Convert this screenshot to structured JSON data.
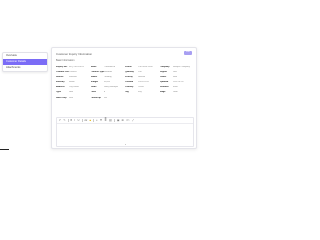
{
  "menu": {
    "items": [
      {
        "label": "Overview",
        "active": false
      },
      {
        "label": "Customer Details",
        "active": true
      },
      {
        "label": "Attachments",
        "active": false
      }
    ]
  },
  "card": {
    "title": "Customer Inquiry Information",
    "action_label": "Edit",
    "subtitle": "Basic Information"
  },
  "fields": [
    {
      "label": "Inquiry No.",
      "value": "INQ-2024-0012"
    },
    {
      "label": "Name",
      "value": "Customer A"
    },
    {
      "label": "Phone",
      "value": "138 0000 0000"
    },
    {
      "label": "Company",
      "value": "Sample Company"
    },
    {
      "label": "Contact Person",
      "value": "Contact"
    },
    {
      "label": "Product Type",
      "value": "Standard"
    },
    {
      "label": "Quantity",
      "value": "100"
    },
    {
      "label": "Region",
      "value": "East"
    },
    {
      "label": "Source",
      "value": "Website"
    },
    {
      "label": "Status",
      "value": "Pending"
    },
    {
      "label": "Priority",
      "value": "Normal"
    },
    {
      "label": "Owner",
      "value": "Staff"
    },
    {
      "label": "Industry",
      "value": "Retail"
    },
    {
      "label": "Budget",
      "value": "10,000"
    },
    {
      "label": "Created",
      "value": "2024-01-01"
    },
    {
      "label": "Updated",
      "value": "2024-01-02"
    },
    {
      "label": "Address",
      "value": "City Road"
    },
    {
      "label": "Email",
      "value": "mail@example"
    },
    {
      "label": "Country",
      "value": "China"
    },
    {
      "label": "Remarks",
      "value": "None"
    },
    {
      "label": "Type",
      "value": "New"
    },
    {
      "label": "Level",
      "value": "A"
    },
    {
      "label": "Tag",
      "value": "Key"
    },
    {
      "label": "Stage",
      "value": "Initial"
    },
    {
      "label": "Sales Rep",
      "value": "Staff"
    },
    {
      "label": "Follow-up",
      "value": "Yes"
    }
  ],
  "editor": {
    "toolbar": [
      {
        "icon": "undo-icon",
        "glyph": "↶"
      },
      {
        "icon": "redo-icon",
        "glyph": "↷"
      },
      {
        "icon": "bold-icon",
        "glyph": "B"
      },
      {
        "icon": "italic-icon",
        "glyph": "I"
      },
      {
        "icon": "underline-icon",
        "glyph": "U"
      },
      {
        "icon": "font-size-icon",
        "glyph": "A▾"
      },
      {
        "icon": "highlight-icon",
        "glyph": "■",
        "color": "#e0b100"
      },
      {
        "icon": "list-icon",
        "glyph": "≡"
      },
      {
        "icon": "ordered-list-icon",
        "glyph": "☰"
      },
      {
        "icon": "align-icon",
        "glyph": "≣"
      },
      {
        "icon": "link-icon",
        "glyph": "⛓"
      },
      {
        "icon": "image-icon",
        "glyph": "▣"
      },
      {
        "icon": "table-icon",
        "glyph": "⊞"
      },
      {
        "icon": "code-icon",
        "glyph": "</>"
      },
      {
        "icon": "fullscreen-icon",
        "glyph": "⤢"
      }
    ]
  }
}
